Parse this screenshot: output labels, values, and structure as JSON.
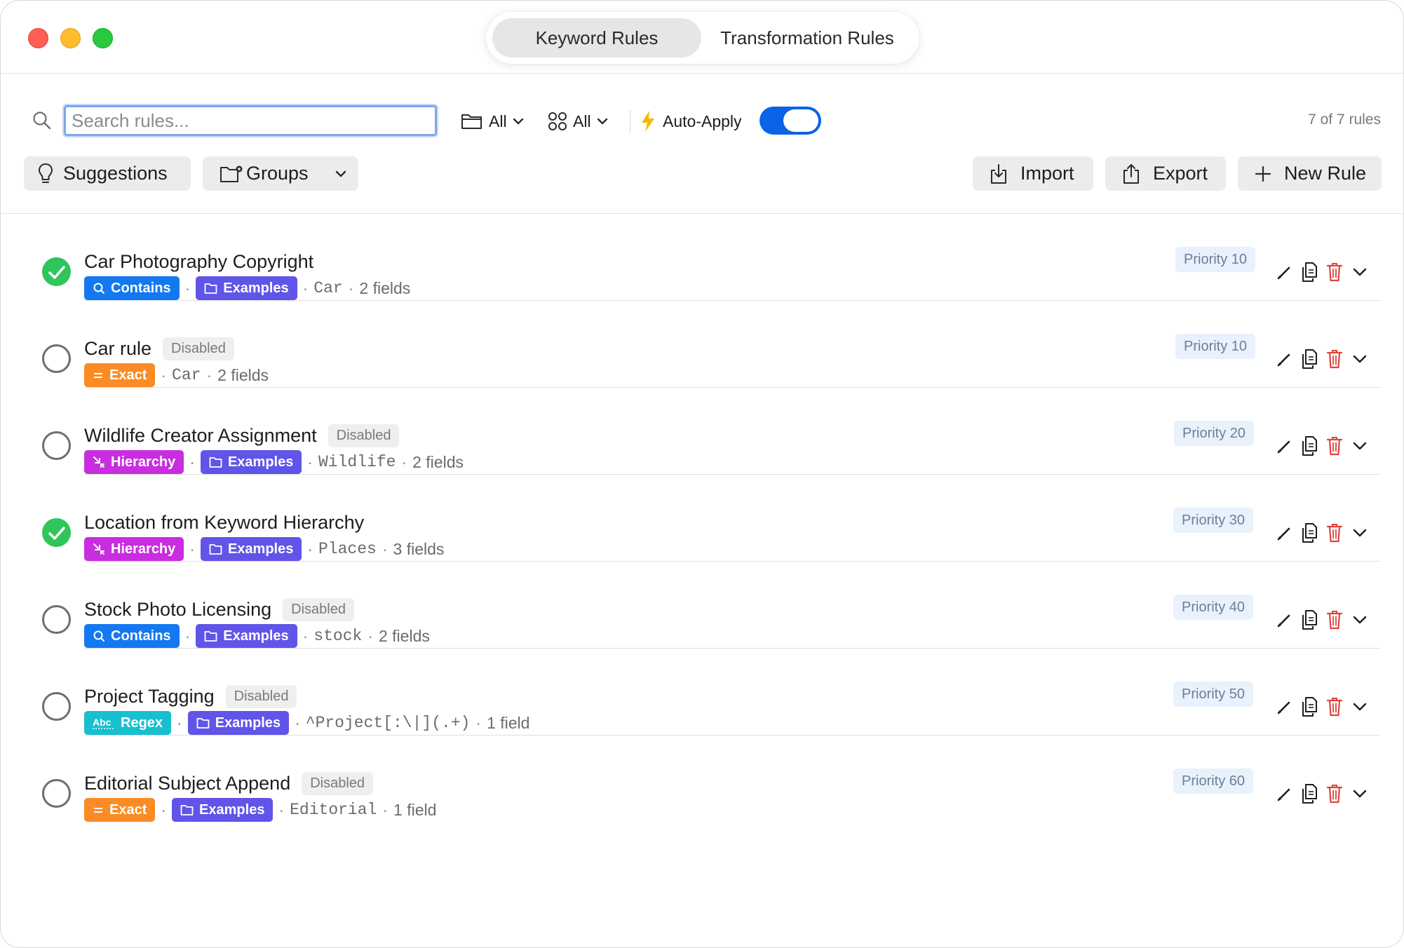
{
  "tabs": [
    {
      "label": "Keyword Rules",
      "active": true
    },
    {
      "label": "Transformation Rules",
      "active": false
    }
  ],
  "search": {
    "placeholder": "Search rules...",
    "value": ""
  },
  "filters": {
    "folder": {
      "label": "All",
      "icon": "folder-icon"
    },
    "groups": {
      "label": "All",
      "icon": "grid-icon"
    }
  },
  "auto_apply": {
    "label": "Auto-Apply",
    "enabled": true
  },
  "rule_count": "7 of 7 rules",
  "buttons": {
    "suggestions": "Suggestions",
    "groups": "Groups",
    "import": "Import",
    "export": "Export",
    "new_rule": "New Rule"
  },
  "colors": {
    "accent": "#0a64e5",
    "enabled": "#30c55a",
    "contains": "#1478f0",
    "exact": "#fb8b24",
    "hierarchy": "#c92de0",
    "regex": "#17bfd0",
    "examples": "#6055e8",
    "delete": "#e0443e"
  },
  "rules": [
    {
      "name": "Car Photography Copyright",
      "enabled": true,
      "disabled_label": "",
      "match_type": "Contains",
      "group": "Examples",
      "keyword": "Car",
      "fields": "2 fields",
      "priority": "Priority 10"
    },
    {
      "name": "Car rule",
      "enabled": false,
      "disabled_label": "Disabled",
      "match_type": "Exact",
      "group": "",
      "keyword": "Car",
      "fields": "2 fields",
      "priority": "Priority 10"
    },
    {
      "name": "Wildlife Creator Assignment",
      "enabled": false,
      "disabled_label": "Disabled",
      "match_type": "Hierarchy",
      "group": "Examples",
      "keyword": "Wildlife",
      "fields": "2 fields",
      "priority": "Priority 20"
    },
    {
      "name": "Location from Keyword Hierarchy",
      "enabled": true,
      "disabled_label": "",
      "match_type": "Hierarchy",
      "group": "Examples",
      "keyword": "Places",
      "fields": "3 fields",
      "priority": "Priority 30"
    },
    {
      "name": "Stock Photo Licensing",
      "enabled": false,
      "disabled_label": "Disabled",
      "match_type": "Contains",
      "group": "Examples",
      "keyword": "stock",
      "fields": "2 fields",
      "priority": "Priority 40"
    },
    {
      "name": "Project Tagging",
      "enabled": false,
      "disabled_label": "Disabled",
      "match_type": "Regex",
      "group": "Examples",
      "keyword": "^Project[:\\|](.+)",
      "fields": "1 field",
      "priority": "Priority 50"
    },
    {
      "name": "Editorial Subject Append",
      "enabled": false,
      "disabled_label": "Disabled",
      "match_type": "Exact",
      "group": "Examples",
      "keyword": "Editorial",
      "fields": "1 field",
      "priority": "Priority 60"
    }
  ]
}
